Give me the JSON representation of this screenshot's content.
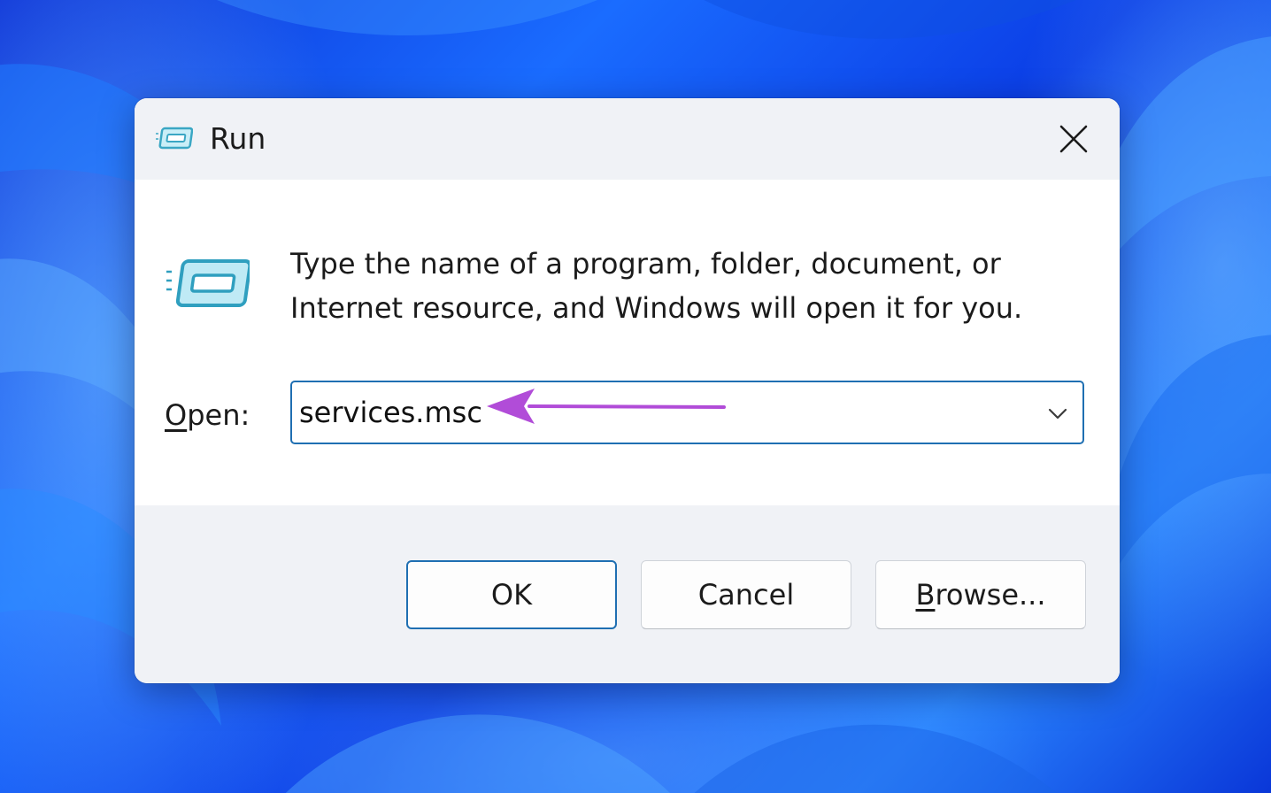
{
  "dialog": {
    "title": "Run",
    "description_line1": "Type the name of a program, folder, document, or",
    "description_line2": "Internet resource, and Windows will open it for you.",
    "open_label_accel": "O",
    "open_label_rest": "pen:",
    "open_value": "services.msc",
    "buttons": {
      "ok": "OK",
      "cancel": "Cancel",
      "browse_accel": "B",
      "browse_rest": "rowse..."
    },
    "icons": {
      "title": "run-app-icon",
      "main": "run-app-icon",
      "close": "close-icon",
      "dropdown": "chevron-down-icon",
      "annotation": "arrow-left-annotation"
    },
    "colors": {
      "focus_border": "#1f6fb2",
      "icon_teal": "#3aa7c4",
      "annotation_arrow": "#b14cd8"
    }
  }
}
